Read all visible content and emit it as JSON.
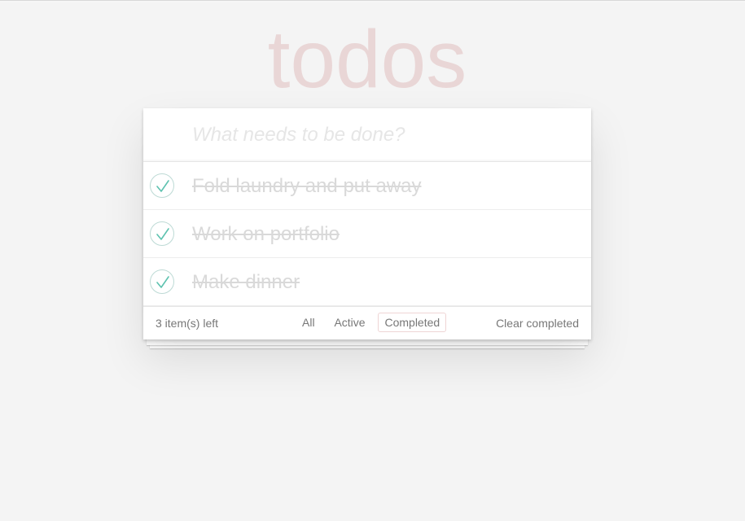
{
  "app": {
    "title": "todos"
  },
  "new_todo": {
    "placeholder": "What needs to be done?",
    "value": ""
  },
  "todos": [
    {
      "label": "Fold laundry and put away",
      "completed": true
    },
    {
      "label": "Work on portfolio",
      "completed": true
    },
    {
      "label": "Make dinner",
      "completed": true
    }
  ],
  "footer": {
    "count_text": "3 item(s) left",
    "filters": [
      {
        "label": "All",
        "selected": false
      },
      {
        "label": "Active",
        "selected": false
      },
      {
        "label": "Completed",
        "selected": true
      }
    ],
    "clear_label": "Clear completed"
  },
  "colors": {
    "background": "#f4f4f4",
    "title": "#af2f2f",
    "check": "#5dc2af",
    "completed_text": "#d9d9d9"
  },
  "icons": {
    "toggle": "check-icon"
  }
}
